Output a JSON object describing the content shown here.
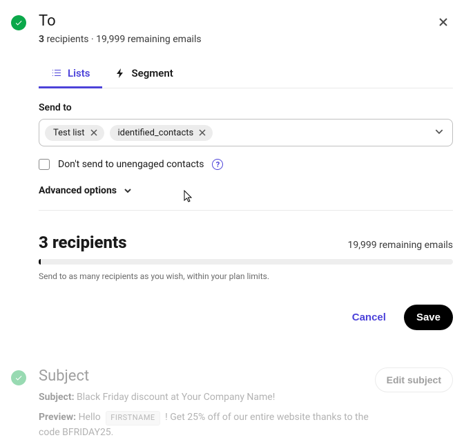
{
  "header": {
    "title": "To",
    "recipients_bold": "3",
    "recipients_word": "recipients",
    "separator": " · ",
    "remaining": "19,999 remaining emails"
  },
  "tabs": {
    "lists": "Lists",
    "segment": "Segment"
  },
  "sendto": {
    "label": "Send to",
    "pills": [
      "Test list",
      "identified_contacts"
    ]
  },
  "unengaged": {
    "label": "Don't send to unengaged contacts"
  },
  "advanced": {
    "label": "Advanced options"
  },
  "recipients": {
    "count": "3 recipients",
    "remaining": "19,999 remaining emails",
    "hint": "Send to as many recipients as you wish, within your plan limits."
  },
  "actions": {
    "cancel": "Cancel",
    "save": "Save"
  },
  "subject": {
    "title": "Subject",
    "edit_label": "Edit subject",
    "subject_label": "Subject:",
    "subject_value": "Black Friday discount at Your Company Name!",
    "preview_label": "Preview:",
    "preview_hello": "Hello",
    "preview_token": "FIRSTNAME",
    "preview_rest": "! Get 25% off of our entire website thanks to the code BFRIDAY25."
  }
}
